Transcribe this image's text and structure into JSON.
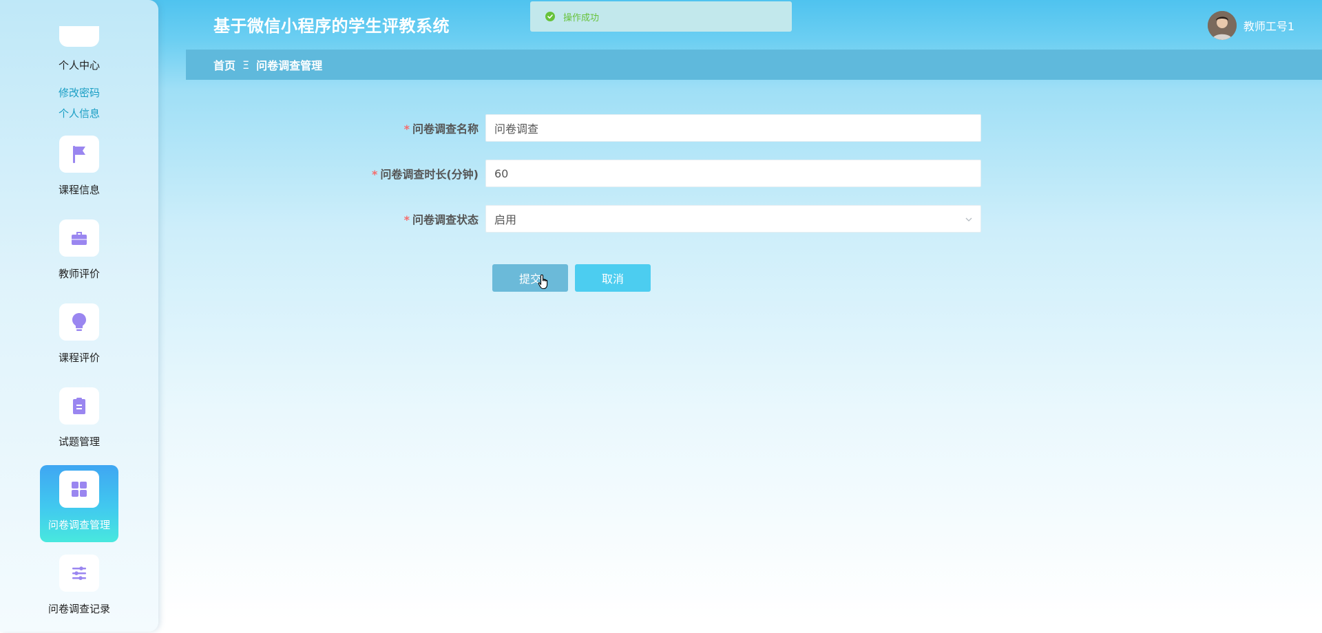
{
  "header": {
    "app_title": "基于微信小程序的学生评教系统",
    "user_name": "教师工号1"
  },
  "toast": {
    "message": "操作成功",
    "icon": "check-circle-icon",
    "color": "#67c23a"
  },
  "breadcrumb": {
    "home": "首页",
    "separator": "Ξ",
    "current": "问卷调查管理"
  },
  "sidebar": {
    "personal_center": "个人中心",
    "change_password": "修改密码",
    "personal_info": "个人信息",
    "items": [
      {
        "label": "课程信息",
        "icon": "flag-icon"
      },
      {
        "label": "教师评价",
        "icon": "briefcase-icon"
      },
      {
        "label": "课程评价",
        "icon": "lightbulb-icon"
      },
      {
        "label": "试题管理",
        "icon": "clipboard-icon"
      },
      {
        "label": "问卷调查管理",
        "icon": "grid-icon",
        "active": true
      },
      {
        "label": "问卷调查记录",
        "icon": "sliders-icon"
      }
    ],
    "accent_color": "#9a86f0"
  },
  "form": {
    "name_label": "问卷调查名称",
    "name_value": "问卷调查",
    "duration_label": "问卷调查时长(分钟)",
    "duration_value": "60",
    "status_label": "问卷调查状态",
    "status_value": "启用",
    "required_mark": "*",
    "submit_label": "提交",
    "cancel_label": "取消"
  }
}
